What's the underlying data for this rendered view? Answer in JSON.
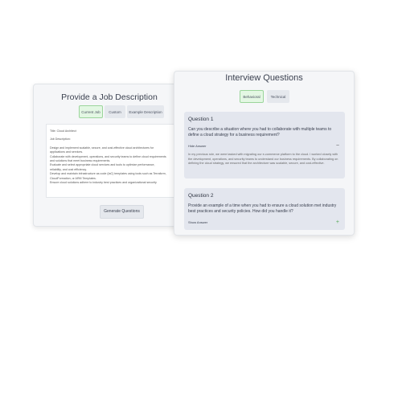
{
  "job_panel": {
    "title": "Provide a Job Description",
    "tabs": [
      "Current Job",
      "Custom",
      "Example Description"
    ],
    "description_lines": [
      "Title: Cloud Architect",
      "",
      "Job Description:",
      "",
      "Design and implement scalable, secure, and cost-effective cloud architectures for",
      "applications and services.",
      "Collaborate with development, operations, and security teams to define cloud requirements",
      "and solutions that meet business requirements.",
      "Evaluate and select appropriate cloud services and tools to optimize performance,",
      "reliability, and cost efficiency.",
      "Develop and maintain infrastructure as code (IaC) templates using tools such as Terraform,",
      "CloudFormation, or ARM Templates.",
      "Ensure cloud solutions adhere to industry best practices and organizational security"
    ],
    "generate_label": "Generate Questions"
  },
  "questions_panel": {
    "title": "Interview Questions",
    "tabs": [
      "Behavioral",
      "Technical"
    ],
    "questions": [
      {
        "heading": "Question 1",
        "text": "Can you describe a situation where you had to collaborate with multiple teams to define a cloud strategy for a business requirement?",
        "toggle_label": "Hide Answer",
        "toggle_icon": "−",
        "answer": "In my previous role, we were tasked with migrating our e-commerce platform to the cloud. I worked closely with the development, operations, and security teams to understand our business requirements. By collaborating on defining the cloud strategy, we ensured that the architecture was scalable, secure, and cost-effective."
      },
      {
        "heading": "Question 2",
        "text": "Provide an example of a time when you had to ensure a cloud solution met industry best practices and security policies. How did you handle it?",
        "toggle_label": "Show Answer",
        "toggle_icon": "+"
      }
    ]
  },
  "colors": {
    "selected_tab_bg": "#e3f7e3",
    "selected_tab_border": "#9bd59b",
    "card_bg": "#f5f6f8",
    "question_bg": "#e3e6ee"
  }
}
